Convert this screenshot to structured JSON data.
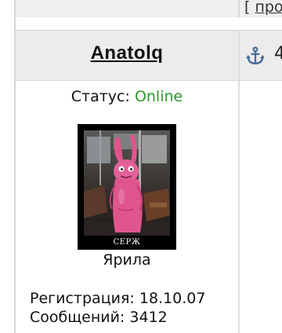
{
  "top_link": {
    "bracket": "[",
    "text": "про"
  },
  "post": {
    "author": "Anatolq",
    "post_number_fragment": "4",
    "status_label": "Статус:",
    "status_value": "Online",
    "status_color": "#2f9a2f",
    "avatar_caption": "СЕРЖ",
    "rank": "Ярила",
    "registration_label": "Регистрация:",
    "registration_date": "18.10.07",
    "posts_label": "Сообщений:",
    "posts_count": "3412",
    "icons": {
      "anchor": "anchor-icon"
    }
  }
}
